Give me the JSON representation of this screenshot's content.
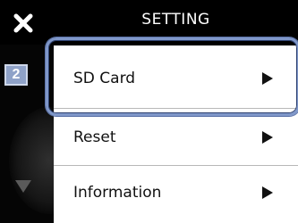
{
  "header": {
    "title": "SETTING",
    "close_icon": "close-icon"
  },
  "sidebar": {
    "page_number": "2",
    "scroll_icon": "down-arrow-icon"
  },
  "menu": {
    "items": [
      {
        "label": "SD Card",
        "arrow_icon": "right-arrow-icon",
        "selected": true
      },
      {
        "label": "Reset",
        "arrow_icon": "right-arrow-icon",
        "selected": false
      },
      {
        "label": "Information",
        "arrow_icon": "right-arrow-icon",
        "selected": false
      }
    ]
  },
  "colors": {
    "highlight": "#7f97c9",
    "badge": "#8fa2c8",
    "menu_bg": "#ffffff",
    "screen_bg": "#000000"
  }
}
